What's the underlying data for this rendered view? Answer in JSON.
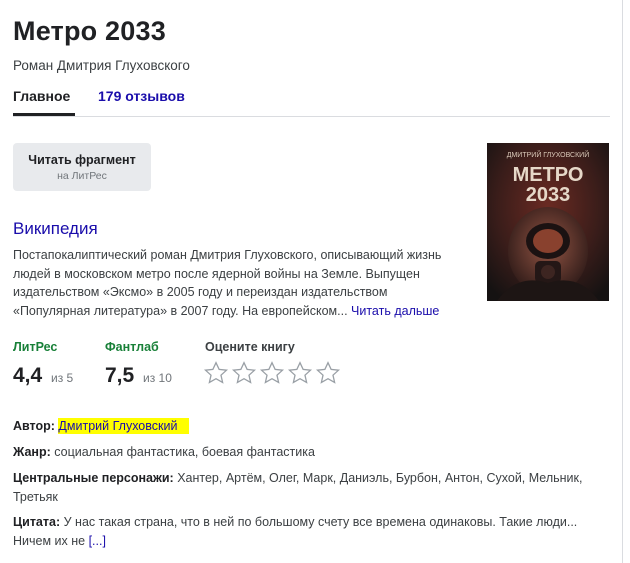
{
  "header": {
    "title": "Метро 2033",
    "subtitle": "Роман Дмитрия Глуховского"
  },
  "tabs": {
    "main": "Главное",
    "reviews": "179 отзывов"
  },
  "read_button": {
    "label": "Читать фрагмент",
    "source": "на ЛитРес"
  },
  "cover": {
    "author": "ДМИТРИЙ ГЛУХОВСКИЙ",
    "title_line1": "МЕТРО",
    "title_line2": "2033"
  },
  "wikipedia": {
    "title": "Википедия",
    "text": "Постапокалиптический роман Дмитрия Глуховского, описывающий жизнь людей в московском метро после ядерной войны на Земле. Выпущен издательством «Эксмо» в 2005 году и переиздан издательством «Популярная литература» в 2007 году. На европейском... ",
    "more_link": "Читать дальше"
  },
  "ratings": {
    "litres": {
      "label": "ЛитРес",
      "value": "4,4",
      "of": "из 5"
    },
    "fantlab": {
      "label": "Фантлаб",
      "value": "7,5",
      "of": "из 10"
    },
    "rate": {
      "label": "Оцените книгу",
      "stars": 5
    }
  },
  "facts": {
    "author": {
      "label": "Автор:",
      "value": "Дмитрий Глуховский"
    },
    "genre": {
      "label": "Жанр:",
      "value": "социальная фантастика, боевая фантастика"
    },
    "characters": {
      "label": "Центральные персонажи:",
      "value": "Хантер, Артём, Олег, Марк, Даниэль, Бурбон, Антон, Сухой, Мельник, Третьяк"
    },
    "quote": {
      "label": "Цитата:",
      "value": "У нас такая страна, что в ней по большому счету все времена одинаковы. Такие люди... Ничем их не ",
      "more": "[...]"
    }
  },
  "colors": {
    "link": "#1a0dab",
    "rating_label": "#188038",
    "highlight": "#ffff00"
  }
}
